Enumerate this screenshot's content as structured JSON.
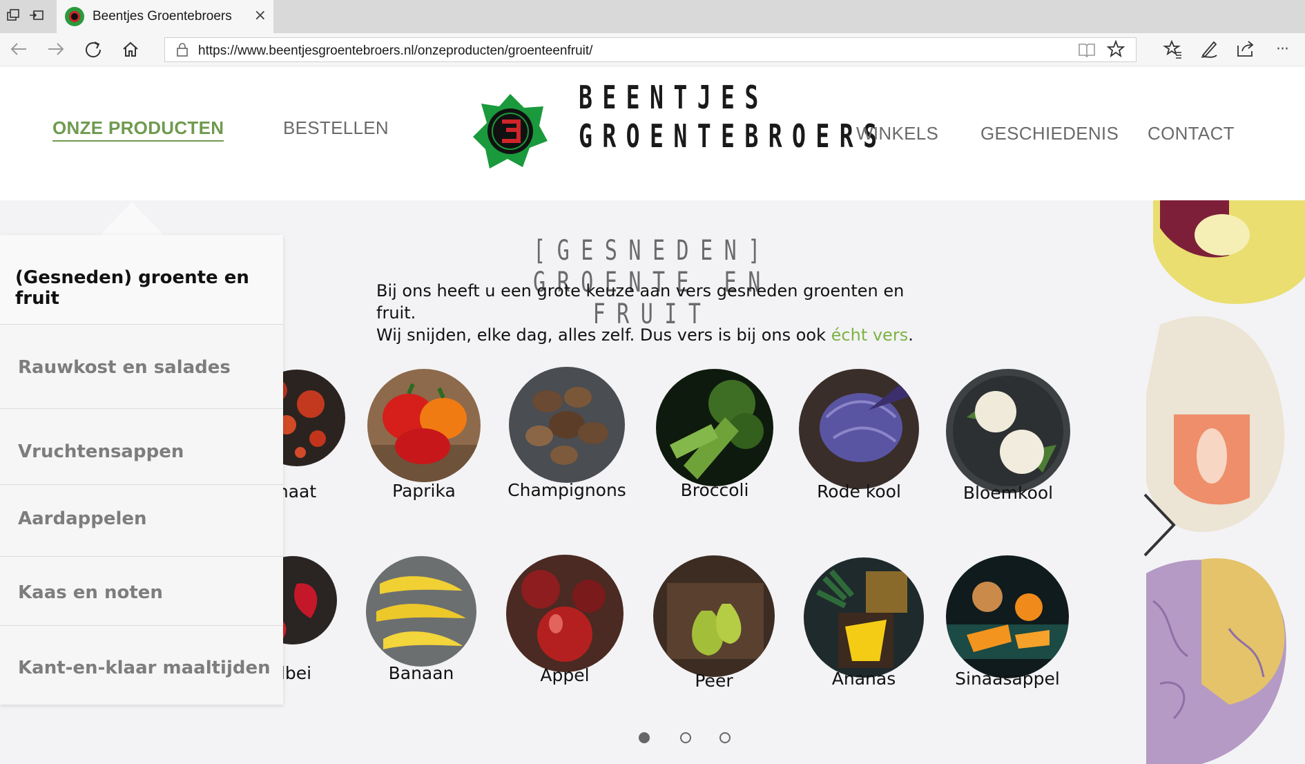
{
  "browser": {
    "tab_title": "Beentjes Groentebroers",
    "tab_close": "×",
    "url": "https://www.beentjesgroentebroers.nl/onzeproducten/groenteenfruit/",
    "nav_icons": [
      "back-icon",
      "forward-icon",
      "refresh-icon",
      "home-icon",
      "lock-icon",
      "reading-view-icon",
      "favorite-star-icon",
      "favorites-hub-icon",
      "pen-icon",
      "share-icon",
      "more-icon"
    ],
    "more": "···"
  },
  "header": {
    "nav_left": [
      "ONZE PRODUCTEN",
      "BESTELLEN"
    ],
    "nav_right": [
      "WINKELS",
      "GESCHIEDENIS",
      "CONTACT"
    ],
    "logo_line1": "BEENTJES",
    "logo_line2": "GROENTEBROERS",
    "brand_green": "#1a9a3c",
    "brand_red": "#d0252a",
    "active_color": "#6f9a4f"
  },
  "main": {
    "title": "[GESNEDEN] GROENTE EN FRUIT",
    "intro_line1": "Bij ons heeft u een grote keuze aan vers gesneden groenten en fruit.",
    "intro_line2_pre": "Wij snijden, elke dag, alles zelf. Dus vers is bij ons ook ",
    "intro_line2_accent": "écht vers",
    "intro_line2_post": ".",
    "accent_color": "#7cb342",
    "row1": [
      "naat",
      "Paprika",
      "Champignons",
      "Broccoli",
      "Rode kool",
      "Bloemkool"
    ],
    "row2": [
      "dbei",
      "Banaan",
      "Appel",
      "Peer",
      "Ananas",
      "Sinaasappel"
    ],
    "carousel_pages": 3,
    "carousel_active": 1
  },
  "dropdown": {
    "items": [
      "(Gesneden) groente en fruit",
      "Rauwkost en salades",
      "Vruchtensappen",
      "Aardappelen",
      "Kaas en noten",
      "Kant-en-klaar maaltijden"
    ]
  }
}
